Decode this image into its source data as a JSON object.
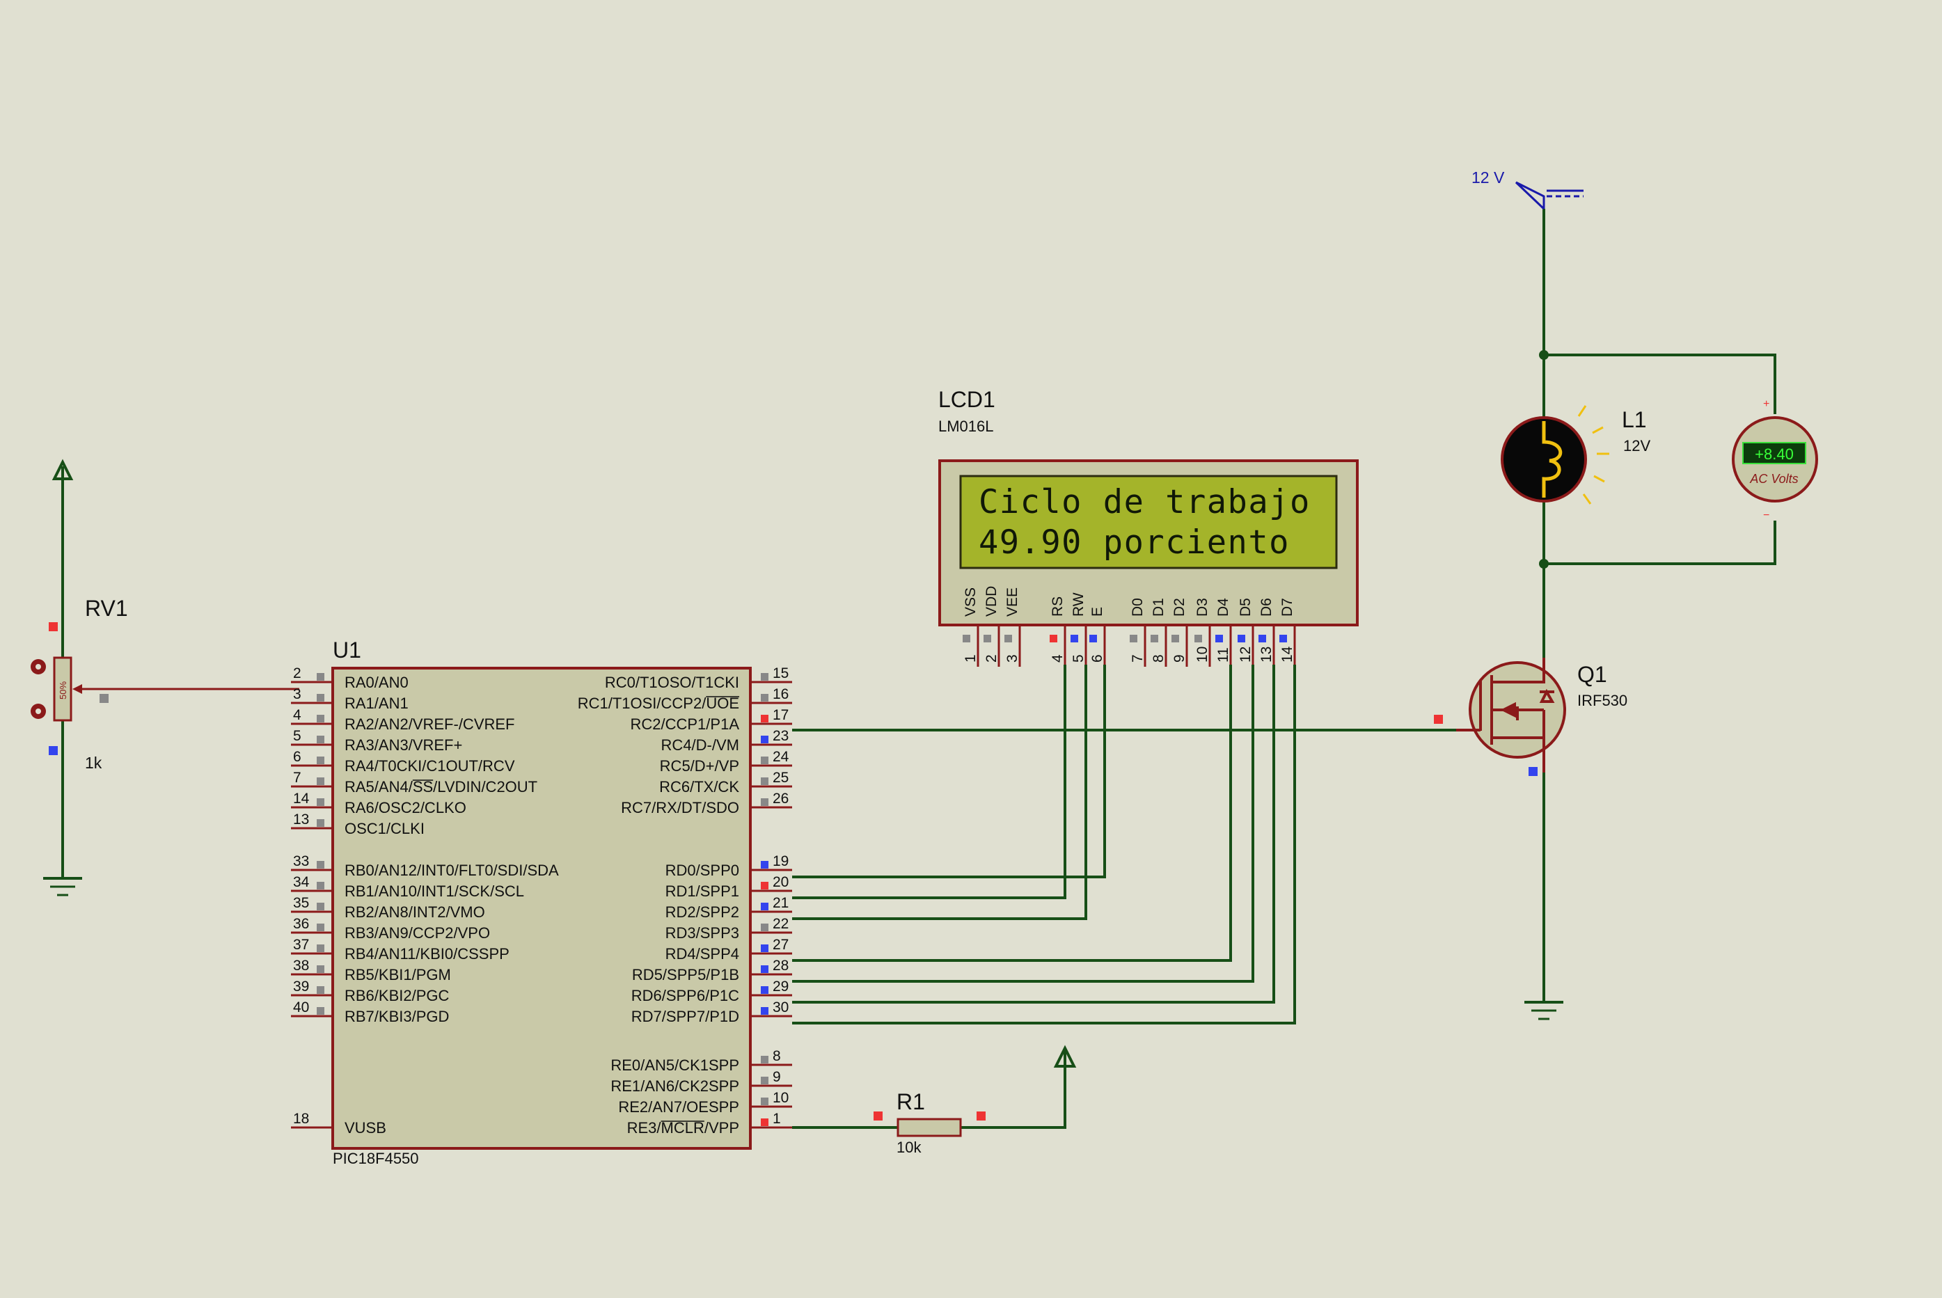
{
  "rv1": {
    "ref": "RV1",
    "value": "1k",
    "percent": "50%"
  },
  "u1": {
    "ref": "U1",
    "part": "PIC18F4550",
    "left_pins": [
      {
        "num": "2",
        "name": "RA0/AN0"
      },
      {
        "num": "3",
        "name": "RA1/AN1"
      },
      {
        "num": "4",
        "name": "RA2/AN2/VREF-/CVREF"
      },
      {
        "num": "5",
        "name": "RA3/AN3/VREF+"
      },
      {
        "num": "6",
        "name": "RA4/T0CKI/C1OUT/RCV"
      },
      {
        "num": "7",
        "name": "RA5/AN4/SS/LVDIN/C2OUT"
      },
      {
        "num": "14",
        "name": "RA6/OSC2/CLKO"
      },
      {
        "num": "13",
        "name": "OSC1/CLKI"
      },
      {
        "num": "33",
        "name": "RB0/AN12/INT0/FLT0/SDI/SDA"
      },
      {
        "num": "34",
        "name": "RB1/AN10/INT1/SCK/SCL"
      },
      {
        "num": "35",
        "name": "RB2/AN8/INT2/VMO"
      },
      {
        "num": "36",
        "name": "RB3/AN9/CCP2/VPO"
      },
      {
        "num": "37",
        "name": "RB4/AN11/KBI0/CSSPP"
      },
      {
        "num": "38",
        "name": "RB5/KBI1/PGM"
      },
      {
        "num": "39",
        "name": "RB6/KBI2/PGC"
      },
      {
        "num": "40",
        "name": "RB7/KBI3/PGD"
      },
      {
        "num": "18",
        "name": "VUSB"
      }
    ],
    "right_pins": [
      {
        "num": "15",
        "name": "RC0/T1OSO/T1CKI"
      },
      {
        "num": "16",
        "name": "RC1/T1OSI/CCP2/UOE"
      },
      {
        "num": "17",
        "name": "RC2/CCP1/P1A"
      },
      {
        "num": "23",
        "name": "RC4/D-/VM"
      },
      {
        "num": "24",
        "name": "RC5/D+/VP"
      },
      {
        "num": "25",
        "name": "RC6/TX/CK"
      },
      {
        "num": "26",
        "name": "RC7/RX/DT/SDO"
      },
      {
        "num": "19",
        "name": "RD0/SPP0"
      },
      {
        "num": "20",
        "name": "RD1/SPP1"
      },
      {
        "num": "21",
        "name": "RD2/SPP2"
      },
      {
        "num": "22",
        "name": "RD3/SPP3"
      },
      {
        "num": "27",
        "name": "RD4/SPP4"
      },
      {
        "num": "28",
        "name": "RD5/SPP5/P1B"
      },
      {
        "num": "29",
        "name": "RD6/SPP6/P1C"
      },
      {
        "num": "30",
        "name": "RD7/SPP7/P1D"
      },
      {
        "num": "8",
        "name": "RE0/AN5/CK1SPP"
      },
      {
        "num": "9",
        "name": "RE1/AN6/CK2SPP"
      },
      {
        "num": "10",
        "name": "RE2/AN7/OESPP"
      },
      {
        "num": "1",
        "name": "RE3/MCLR/VPP"
      }
    ]
  },
  "lcd1": {
    "ref": "LCD1",
    "part": "LM016L",
    "line1": "Ciclo de trabajo",
    "line2": "49.90 porciento",
    "pins": [
      {
        "num": "1",
        "name": "VSS"
      },
      {
        "num": "2",
        "name": "VDD"
      },
      {
        "num": "3",
        "name": "VEE"
      },
      {
        "num": "4",
        "name": "RS"
      },
      {
        "num": "5",
        "name": "RW"
      },
      {
        "num": "6",
        "name": "E"
      },
      {
        "num": "7",
        "name": "D0"
      },
      {
        "num": "8",
        "name": "D1"
      },
      {
        "num": "9",
        "name": "D2"
      },
      {
        "num": "10",
        "name": "D3"
      },
      {
        "num": "11",
        "name": "D4"
      },
      {
        "num": "12",
        "name": "D5"
      },
      {
        "num": "13",
        "name": "D6"
      },
      {
        "num": "14",
        "name": "D7"
      }
    ]
  },
  "r1": {
    "ref": "R1",
    "value": "10k"
  },
  "l1": {
    "ref": "L1",
    "value": "12V"
  },
  "q1": {
    "ref": "Q1",
    "part": "IRF530"
  },
  "supply": {
    "label": "12 V"
  },
  "voltmeter": {
    "reading": "+8.40",
    "label": "AC Volts",
    "plus": "+",
    "minus": "−"
  },
  "colors": {
    "background": "#e0e0d1",
    "wire": "#174f17",
    "component": "#8b1a1a",
    "ic_fill": "#c9c9a8",
    "lcd_screen": "#a4b42a",
    "pin_red": "#ee3333",
    "pin_blue": "#3344ee",
    "pin_gray": "#888888",
    "supply_blue": "#1a1aaa"
  }
}
